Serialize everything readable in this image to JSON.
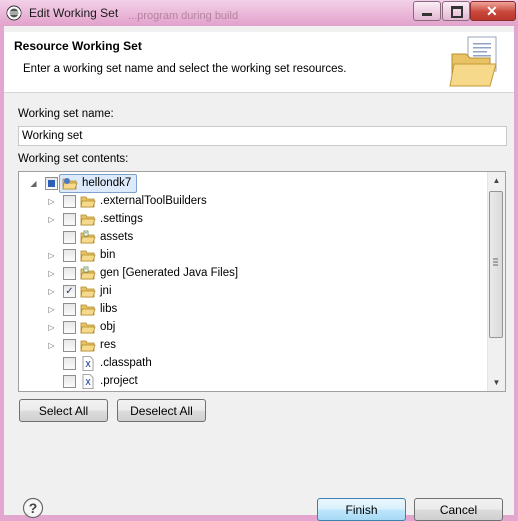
{
  "window": {
    "title": "Edit Working Set",
    "background_title": "...program during build"
  },
  "header": {
    "title": "Resource Working Set",
    "description": "Enter a working set name and select the working set resources.",
    "icon": "folder-document-icon"
  },
  "form": {
    "name_label": "Working set name:",
    "name_value": "Working set",
    "contents_label": "Working set contents:"
  },
  "tree": {
    "items": [
      {
        "label": "hellondk7",
        "level": 0,
        "expandable": true,
        "expanded": true,
        "check": "partial",
        "icon": "project-folder-icon",
        "selected": true
      },
      {
        "label": ".externalToolBuilders",
        "level": 1,
        "expandable": true,
        "check": "unchecked",
        "icon": "folder-icon"
      },
      {
        "label": ".settings",
        "level": 1,
        "expandable": true,
        "check": "unchecked",
        "icon": "folder-icon"
      },
      {
        "label": "assets",
        "level": 1,
        "expandable": false,
        "check": "unchecked",
        "icon": "source-folder-icon"
      },
      {
        "label": "bin",
        "level": 1,
        "expandable": true,
        "check": "unchecked",
        "icon": "folder-icon"
      },
      {
        "label": "gen [Generated Java Files]",
        "level": 1,
        "expandable": true,
        "check": "unchecked",
        "icon": "source-folder-icon"
      },
      {
        "label": "jni",
        "level": 1,
        "expandable": true,
        "check": "checked",
        "icon": "folder-icon"
      },
      {
        "label": "libs",
        "level": 1,
        "expandable": true,
        "check": "unchecked",
        "icon": "folder-icon"
      },
      {
        "label": "obj",
        "level": 1,
        "expandable": true,
        "check": "unchecked",
        "icon": "folder-icon"
      },
      {
        "label": "res",
        "level": 1,
        "expandable": true,
        "check": "unchecked",
        "icon": "folder-icon"
      },
      {
        "label": ".classpath",
        "level": 1,
        "expandable": false,
        "check": "unchecked",
        "icon": "xml-file-icon"
      },
      {
        "label": ".project",
        "level": 1,
        "expandable": false,
        "check": "unchecked",
        "icon": "xml-file-icon"
      }
    ]
  },
  "buttons": {
    "select_all": "Select All",
    "deselect_all": "Deselect All",
    "finish": "Finish",
    "cancel": "Cancel"
  },
  "colors": {
    "accent": "#3c7fb1",
    "window_frame": "#e3a6cf",
    "close_button": "#c9473a"
  }
}
